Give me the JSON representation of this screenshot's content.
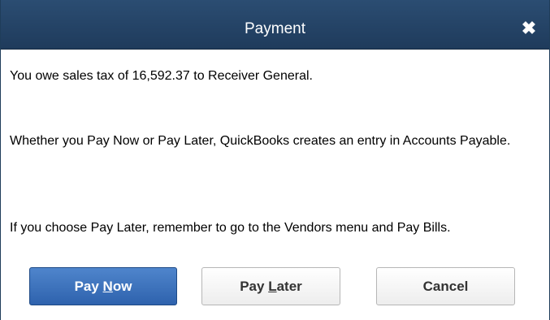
{
  "window": {
    "title": "Payment",
    "close_glyph": "✖"
  },
  "message": {
    "line1": "You owe sales tax of  16,592.37 to Receiver General.",
    "line2": "Whether you Pay Now or Pay Later, QuickBooks creates an entry in Accounts Payable.",
    "line3": "If you choose Pay Later, remember to go to the Vendors menu and Pay Bills."
  },
  "buttons": {
    "pay_now": {
      "prefix": "Pay ",
      "accel": "N",
      "suffix": "ow"
    },
    "pay_later": {
      "prefix": "Pay ",
      "accel": "L",
      "suffix": "ater"
    },
    "cancel": {
      "label": "Cancel"
    }
  },
  "colors": {
    "titlebar": "#1f3b5c",
    "primary_button": "#3a6fba",
    "primary_button_text": "#ffffff"
  },
  "icons": {
    "close": "close-icon"
  }
}
